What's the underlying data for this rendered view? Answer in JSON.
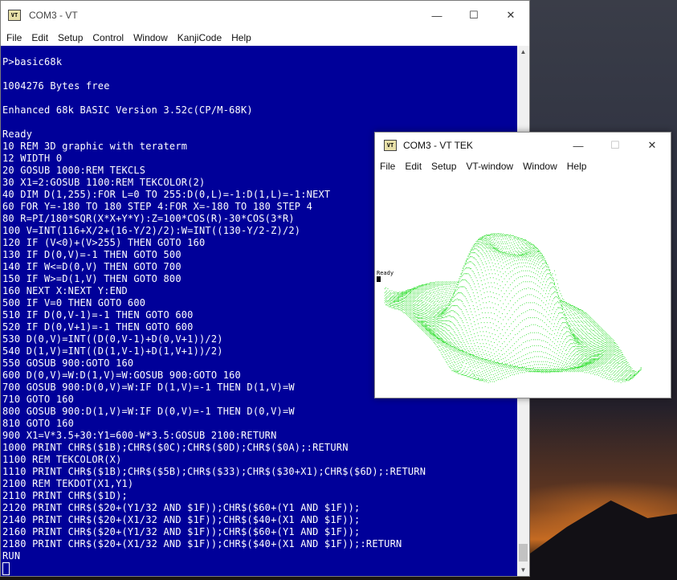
{
  "vt": {
    "title": "COM3 - VT",
    "menu": [
      "File",
      "Edit",
      "Setup",
      "Control",
      "Window",
      "KanjiCode",
      "Help"
    ],
    "terminal_text": "P>basic68k\n\n1004276 Bytes free\n\nEnhanced 68k BASIC Version 3.52c(CP/M-68K)\n\nReady\n10 REM 3D graphic with teraterm\n12 WIDTH 0\n20 GOSUB 1000:REM TEKCLS\n30 X1=2:GOSUB 1100:REM TEKCOLOR(2)\n40 DIM D(1,255):FOR L=0 TO 255:D(0,L)=-1:D(1,L)=-1:NEXT\n60 FOR Y=-180 TO 180 STEP 4:FOR X=-180 TO 180 STEP 4\n80 R=PI/180*SQR(X*X+Y*Y):Z=100*COS(R)-30*COS(3*R)\n100 V=INT(116+X/2+(16-Y/2)/2):W=INT((130-Y/2-Z)/2)\n120 IF (V<0)+(V>255) THEN GOTO 160\n130 IF D(0,V)=-1 THEN GOTO 500\n140 IF W<=D(0,V) THEN GOTO 700\n150 IF W>=D(1,V) THEN GOTO 800\n160 NEXT X:NEXT Y:END\n500 IF V=0 THEN GOTO 600\n510 IF D(0,V-1)=-1 THEN GOTO 600\n520 IF D(0,V+1)=-1 THEN GOTO 600\n530 D(0,V)=INT((D(0,V-1)+D(0,V+1))/2)\n540 D(1,V)=INT((D(1,V-1)+D(1,V+1))/2)\n550 GOSUB 900:GOTO 160\n600 D(0,V)=W:D(1,V)=W:GOSUB 900:GOTO 160\n700 GOSUB 900:D(0,V)=W:IF D(1,V)=-1 THEN D(1,V)=W\n710 GOTO 160\n800 GOSUB 900:D(1,V)=W:IF D(0,V)=-1 THEN D(0,V)=W\n810 GOTO 160\n900 X1=V*3.5+30:Y1=600-W*3.5:GOSUB 2100:RETURN\n1000 PRINT CHR$($1B);CHR$($0C);CHR$($0D);CHR$($0A);:RETURN\n1100 REM TEKCOLOR(X)\n1110 PRINT CHR$($1B);CHR$($5B);CHR$($33);CHR$($30+X1);CHR$($6D);:RETURN\n2100 REM TEKDOT(X1,Y1)\n2110 PRINT CHR$($1D);\n2120 PRINT CHR$($20+(Y1/32 AND $1F));CHR$($60+(Y1 AND $1F));\n2140 PRINT CHR$($20+(X1/32 AND $1F));CHR$($40+(X1 AND $1F));\n2160 PRINT CHR$($20+(Y1/32 AND $1F));CHR$($60+(Y1 AND $1F));\n2180 PRINT CHR$($20+(X1/32 AND $1F));CHR$($40+(X1 AND $1F));:RETURN\nRUN"
  },
  "tek": {
    "title": "COM3 - VT TEK",
    "menu": [
      "File",
      "Edit",
      "Setup",
      "VT-window",
      "Window",
      "Help"
    ],
    "ready_text": "Ready",
    "plot_color": "#22dd22"
  },
  "colors": {
    "terminal_bg": "#000099",
    "terminal_fg": "#ffffff"
  },
  "icons": {
    "app": "VT"
  }
}
